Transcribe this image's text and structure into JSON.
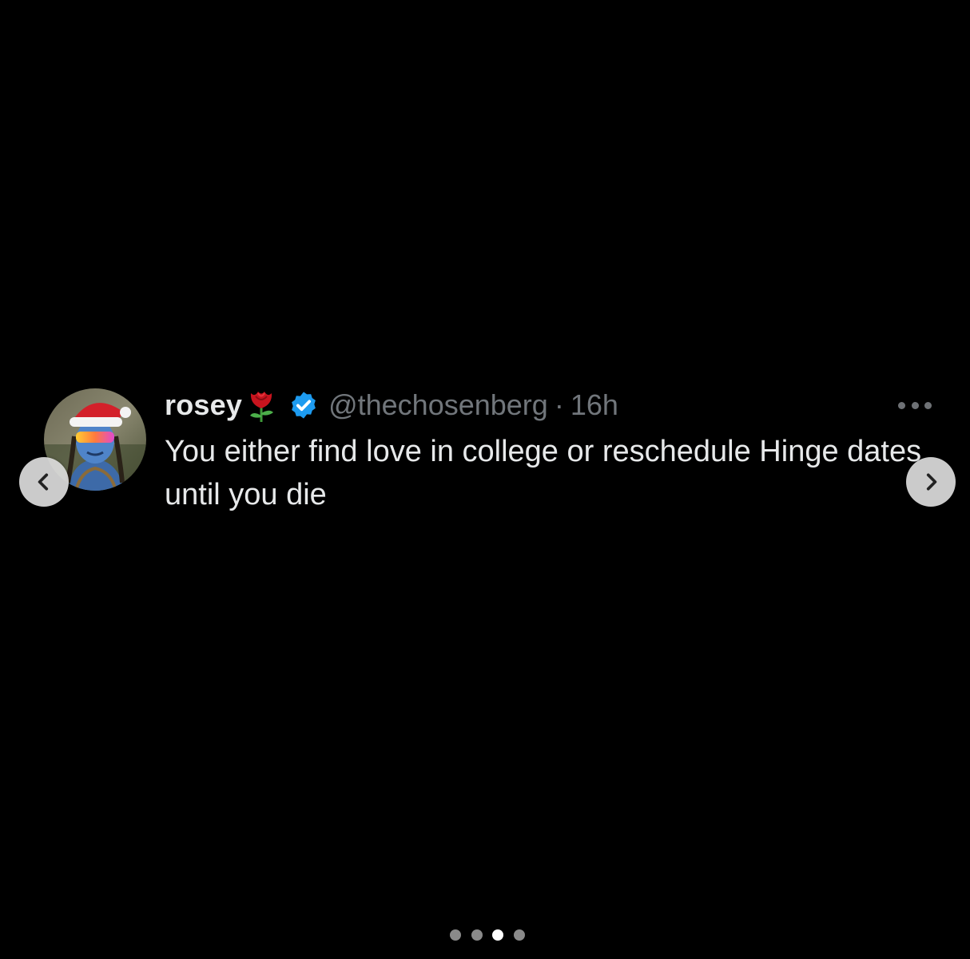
{
  "tweet": {
    "display_name": "rosey",
    "name_emoji": "rose-emoji",
    "verified_icon": "verified-badge-icon",
    "handle": "@thechosenberg",
    "separator": "·",
    "time": "16h",
    "text": "You either find love in college or reschedule Hinge dates until you die",
    "more_icon": "more-options-icon"
  },
  "carousel": {
    "prev_icon": "chevron-left-icon",
    "next_icon": "chevron-right-icon",
    "slide_count": 4,
    "active_index": 2
  },
  "colors": {
    "background": "#000000",
    "text_primary": "#e7e9ea",
    "text_secondary": "#71767b",
    "verified_blue": "#1d9bf0",
    "nav_button": "#dcdcdc",
    "dot_inactive": "#8a8a8a",
    "dot_active": "#ffffff"
  }
}
